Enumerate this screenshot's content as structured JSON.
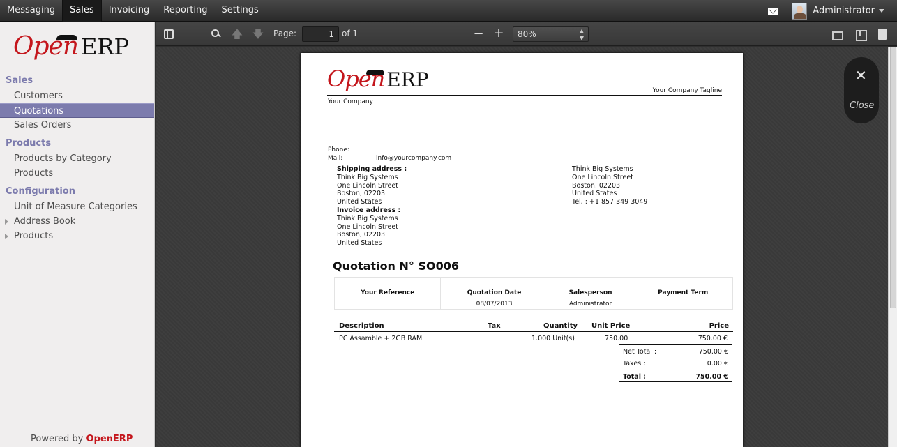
{
  "topbar": {
    "menu": [
      {
        "label": "Messaging",
        "active": false
      },
      {
        "label": "Sales",
        "active": true
      },
      {
        "label": "Invoicing",
        "active": false
      },
      {
        "label": "Reporting",
        "active": false
      },
      {
        "label": "Settings",
        "active": false
      }
    ],
    "user_name": "Administrator"
  },
  "sidebar": {
    "logo_open": "Open",
    "logo_erp": "ERP",
    "sections": [
      {
        "title": "Sales",
        "items": [
          "Customers",
          "Quotations",
          "Sales Orders"
        ]
      },
      {
        "title": "Products",
        "items": [
          "Products by Category",
          "Products"
        ]
      },
      {
        "title": "Configuration",
        "items": [
          "Unit of Measure Categories",
          "Address Book",
          "Products"
        ]
      }
    ],
    "active_item": "Quotations",
    "powered_prefix": "Powered by",
    "powered_brand": "OpenERP"
  },
  "pdf_toolbar": {
    "page_label": "Page:",
    "page_value": "1",
    "page_of": "of 1",
    "zoom_value": "80%"
  },
  "document": {
    "logo_open": "Open",
    "logo_erp": "ERP",
    "tagline": "Your Company Tagline",
    "company": "Your Company",
    "phone_label": "Phone:",
    "mail_label": "Mail:",
    "mail_value": "info@yourcompany.com",
    "shipping_label": "Shipping address :",
    "shipping_lines": [
      "Think Big Systems",
      "One Lincoln Street",
      "Boston, 02203",
      "United States"
    ],
    "invoice_label": "Invoice address :",
    "invoice_lines": [
      "Think Big Systems",
      "One Lincoln Street",
      "Boston, 02203",
      "United States"
    ],
    "partner_lines": [
      "Think Big Systems",
      "One Lincoln Street",
      "Boston, 02203",
      "United States",
      "Tel. : +1 857 349 3049"
    ],
    "title": "Quotation N° SO006",
    "ref_headers": [
      "Your Reference",
      "Quotation Date",
      "Salesperson",
      "Payment Term"
    ],
    "ref_values": [
      "",
      "08/07/2013",
      "Administrator",
      ""
    ],
    "line_headers": {
      "description": "Description",
      "tax": "Tax",
      "quantity": "Quantity",
      "unit_price": "Unit Price",
      "price": "Price"
    },
    "lines": [
      {
        "description": "PC Assamble + 2GB RAM",
        "tax": "",
        "quantity": "1.000 Unit(s)",
        "unit_price": "750.00",
        "price": "750.00 €"
      }
    ],
    "totals": [
      {
        "label": "Net Total :",
        "value": "750.00 €"
      },
      {
        "label": "Taxes :",
        "value": "0.00 €"
      },
      {
        "label": "Total :",
        "value": "750.00 €"
      }
    ]
  },
  "close_panel": {
    "label": "Close"
  }
}
